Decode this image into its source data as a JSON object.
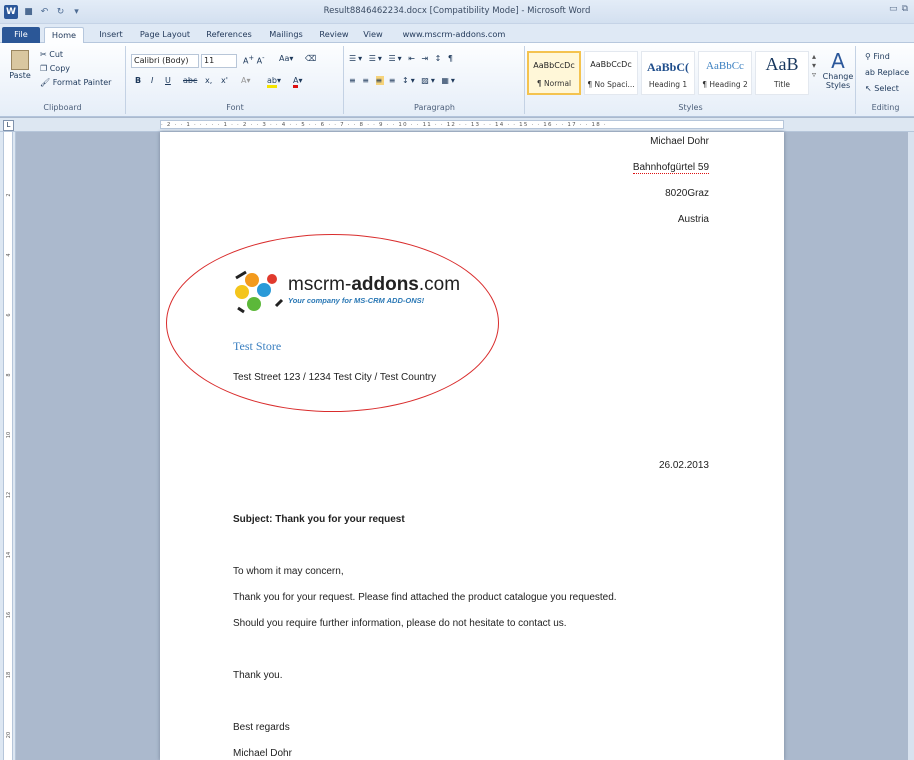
{
  "titlebar": {
    "title": "Result8846462234.docx [Compatibility Mode] - Microsoft Word",
    "app_icon": "W"
  },
  "tabs": [
    "File",
    "Home",
    "Insert",
    "Page Layout",
    "References",
    "Mailings",
    "Review",
    "View",
    "www.mscrm-addons.com"
  ],
  "ribbon": {
    "clipboard": {
      "paste": "Paste",
      "cut": "Cut",
      "copy": "Copy",
      "format_painter": "Format Painter",
      "label": "Clipboard"
    },
    "font": {
      "name": "Calibri (Body)",
      "size": "11",
      "label": "Font",
      "bold": "B",
      "italic": "I",
      "underline": "U",
      "strike": "abc",
      "sub": "x,",
      "sup": "x'"
    },
    "paragraph": {
      "label": "Paragraph"
    },
    "styles": {
      "label": "Styles",
      "items": [
        {
          "sample": "AaBbCcDc",
          "name": "¶ Normal"
        },
        {
          "sample": "AaBbCcDc",
          "name": "¶ No Spaci..."
        },
        {
          "sample": "AaBbC(",
          "name": "Heading 1"
        },
        {
          "sample": "AaBbCc",
          "name": "¶ Heading 2"
        },
        {
          "sample": "AaB",
          "name": "Title"
        }
      ],
      "change_styles": "Change Styles"
    },
    "editing": {
      "find": "Find",
      "replace": "Replace",
      "select": "Select",
      "label": "Editing"
    }
  },
  "document": {
    "sender": {
      "name": "Michael Dohr",
      "street": "Bahnhofgürtel 59",
      "city": "8020Graz",
      "country": "Austria"
    },
    "logo": {
      "brand_prefix": "mscrm-",
      "brand_bold": "addons",
      "brand_suffix": ".com",
      "tagline": "Your company for MS-CRM ADD-ONS!"
    },
    "recipient": {
      "company": "Test Store",
      "address": "Test Street 123 / 1234 Test City / Test Country"
    },
    "date": "26.02.2013",
    "subject": "Subject: Thank you for your request",
    "greeting": "To whom it may concern,",
    "body_1": "Thank you for your request. Please find attached the product catalogue you requested.",
    "body_2": "Should you require further information, please do not hesitate to contact us.",
    "thanks": "Thank you.",
    "closing": "Best regards",
    "signature": "Michael Dohr"
  },
  "colors": {
    "file_tab": "#2b5797",
    "annotation": "#d92c2c",
    "company": "#3a7fc0"
  }
}
